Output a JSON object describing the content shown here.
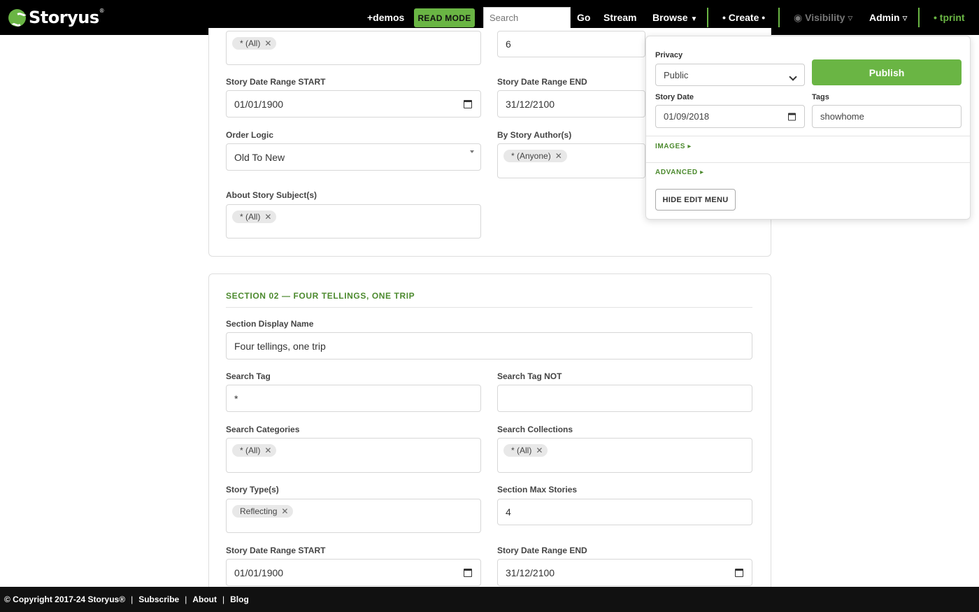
{
  "nav": {
    "brand": "Storyus",
    "brand_mark": "®",
    "demos": "+demos",
    "read_mode": "READ MODE",
    "search_placeholder": "Search",
    "go": "Go",
    "stream": "Stream",
    "browse": "Browse",
    "create": "• Create •",
    "visibility": "Visibility ▿",
    "admin": "Admin ▿",
    "user": "• tprint"
  },
  "section1": {
    "chip_top": "* (All)",
    "top_right_value": "6",
    "date_start_label": "Story Date Range START",
    "date_start_value": "01/01/1900",
    "date_end_label": "Story Date Range END",
    "date_end_value": "31/12/2100",
    "order_label": "Order Logic",
    "order_value": "Old To New",
    "author_label": "By Story Author(s)",
    "author_chip": "* (Anyone)",
    "subject_label": "About Story Subject(s)",
    "subject_chip": "* (All)"
  },
  "section2": {
    "title": "SECTION 02 — FOUR TELLINGS, ONE TRIP",
    "display_name_label": "Section Display Name",
    "display_name_value": "Four tellings, one trip",
    "search_tag_label": "Search Tag",
    "search_tag_value": "*",
    "search_tag_not_label": "Search Tag NOT",
    "search_tag_not_value": "",
    "categories_label": "Search Categories",
    "categories_chip": "* (All)",
    "collections_label": "Search Collections",
    "collections_chip": "* (All)",
    "types_label": "Story Type(s)",
    "types_chip": "Reflecting",
    "max_label": "Section Max Stories",
    "max_value": "4",
    "date_start_label": "Story Date Range START",
    "date_start_value": "01/01/1900",
    "date_end_label": "Story Date Range END",
    "date_end_value": "31/12/2100"
  },
  "panel": {
    "privacy_label": "Privacy",
    "privacy_value": "Public",
    "publish": "Publish",
    "story_date_label": "Story Date",
    "story_date_value": "01/09/2018",
    "tags_label": "Tags",
    "tags_value": "showhome",
    "images": "IMAGES ▸",
    "advanced": "ADVANCED ▸",
    "hide": "HIDE EDIT MENU"
  },
  "footer": {
    "copyright": "© Copyright 2017-24 Storyus®",
    "subscribe": "Subscribe",
    "about": "About",
    "blog": "Blog",
    "separator": "|"
  },
  "colors": {
    "accent_green": "#6ab544",
    "section_green": "#4c8a2e",
    "nav_bg": "#000000"
  }
}
